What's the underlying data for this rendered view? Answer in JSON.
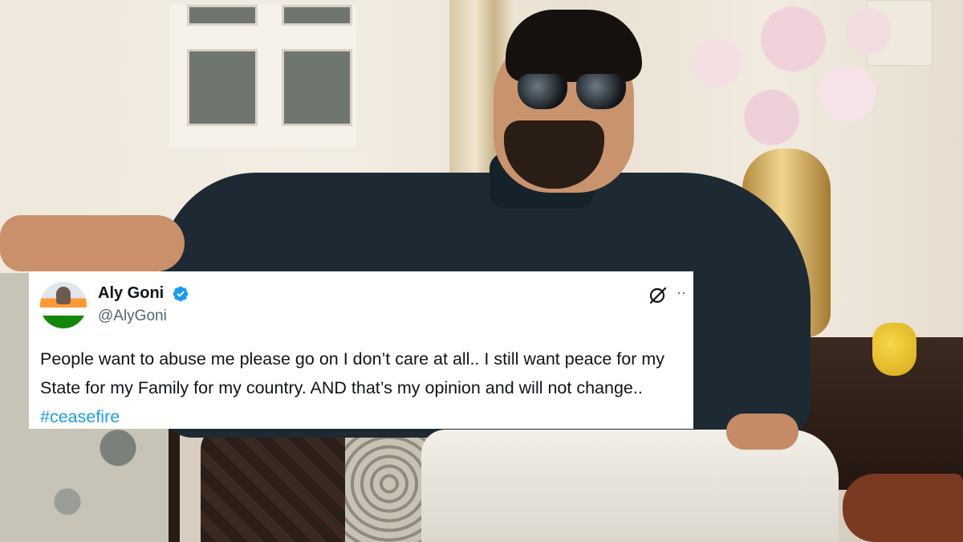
{
  "tweet": {
    "author_name": "Aly Goni",
    "author_handle": "@AlyGoni",
    "verified": true,
    "text": "People want to abuse me please go on I don’t care at all.. I still want peace for my State for my Family for my country. AND that’s my opinion and will not change.. ",
    "hashtag": "#ceasefire",
    "icons": {
      "avatar": "avatar-with-indian-flag",
      "verified": "verified-badge-icon",
      "grok": "grok-icon",
      "more": "more-options-icon"
    },
    "more_glyph": "··"
  },
  "colors": {
    "card_background": "#ffffff",
    "name_text": "#0f1419",
    "handle_text": "#536471",
    "hashtag": "#1d9bf0",
    "verified_badge": "#1d9bf0"
  }
}
